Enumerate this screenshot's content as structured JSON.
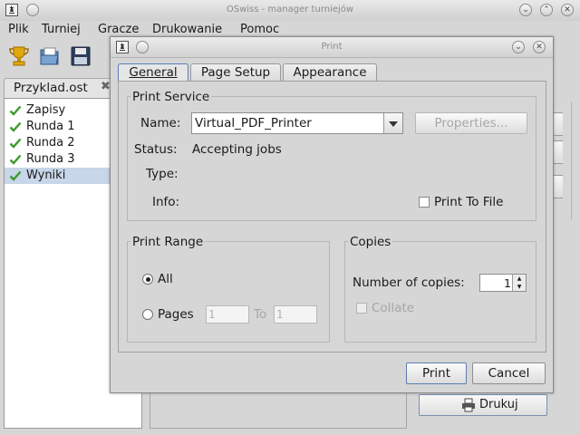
{
  "main": {
    "title": "OSwiss - manager turniejów",
    "menu": [
      "Plik",
      "Turniej",
      "Gracze",
      "Drukowanie",
      "Pomoc"
    ],
    "document_tab": "Przyklad.ost",
    "tree_items": [
      {
        "label": "Zapisy",
        "status": "done",
        "selected": false
      },
      {
        "label": "Runda 1",
        "status": "done",
        "selected": false
      },
      {
        "label": "Runda 2",
        "status": "done",
        "selected": false
      },
      {
        "label": "Runda 3",
        "status": "done",
        "selected": false
      },
      {
        "label": "Wyniki",
        "status": "done",
        "selected": true
      }
    ],
    "print_button": "Drukuj",
    "toolbar_icons": [
      "trophy-icon",
      "open-folder-icon",
      "save-disk-icon"
    ]
  },
  "dialog": {
    "title": "Print",
    "tabs": [
      {
        "label": "General",
        "active": true
      },
      {
        "label": "Page Setup",
        "active": false
      },
      {
        "label": "Appearance",
        "active": false
      }
    ],
    "print_service": {
      "title": "Print Service",
      "name_label": "Name:",
      "name_value": "Virtual_PDF_Printer",
      "properties_button": "Properties...",
      "status_label": "Status:",
      "status_value": "Accepting jobs",
      "type_label": "Type:",
      "type_value": "",
      "info_label": "Info:",
      "info_value": "",
      "print_to_file_label": "Print To File",
      "print_to_file_checked": false
    },
    "print_range": {
      "title": "Print Range",
      "all_label": "All",
      "pages_label": "Pages",
      "selected": "All",
      "from_value": "1",
      "to_label": "To",
      "to_value": "1"
    },
    "copies": {
      "title": "Copies",
      "number_label": "Number of copies:",
      "number_value": "1",
      "collate_label": "Collate",
      "collate_checked": false
    },
    "print_button": "Print",
    "cancel_button": "Cancel"
  },
  "colors": {
    "selection": "#c7d6e8",
    "check_green": "#3c9a2a",
    "default_button_border": "#5c7db0"
  }
}
